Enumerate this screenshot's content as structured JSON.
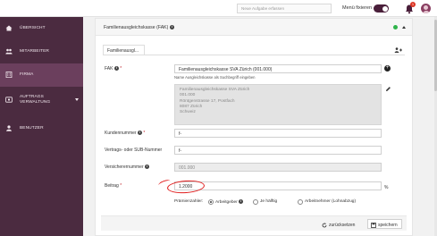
{
  "topbar": {
    "search_placeholder": "Neue Aufgabe erfassen",
    "menu_fix_label": "Menü fixieren",
    "notifications_count": "1"
  },
  "sidebar": {
    "items": [
      {
        "label": "Übersicht",
        "icon": "home-icon"
      },
      {
        "label": "Mitarbeiter",
        "icon": "users-icon"
      },
      {
        "label": "Firma",
        "icon": "building-icon",
        "active": true
      },
      {
        "label_line1": "Auftrags",
        "label_line2": "Verwaltung",
        "icon": "orders-icon"
      },
      {
        "label": "Benutzer",
        "icon": "user-icon"
      }
    ]
  },
  "panel": {
    "title": "Familienausgleichskasse (FAK)",
    "tab": "Familienausgl..."
  },
  "form": {
    "fak_label": "FAK",
    "fak_value": "Familienausgleichskasse SVA Zürich (001.000)",
    "fak_hint": "Name Ausgleichskasse als Suchbegriff eingeben",
    "address_lines": [
      "Familienausgleichskasse SVA Zürich",
      "001.000",
      "Röntgenstrasse 17, Postfach",
      "8087 Zürich",
      "Schweiz"
    ],
    "kundennummer_label": "Kundennummer",
    "kundennummer_value": "f-",
    "vertrag_label": "Vertrags- oder SUB-Nummer",
    "vertrag_value": "f-",
    "versicherer_label": "Versicherernummer",
    "versicherer_value": "001.000",
    "beitrag_label": "Beitrag",
    "beitrag_value": "1.2000",
    "percent_unit": "%",
    "praemien_label": "Prämienzahler:",
    "radio_options": [
      {
        "label": "Arbeitgeber",
        "selected": true
      },
      {
        "label": "Je hälftig",
        "selected": false
      },
      {
        "label": "Arbeitnehmer (Lohnabzug)",
        "selected": false
      }
    ]
  },
  "footer": {
    "reset_label": "zurücksetzen",
    "save_label": "speichern"
  },
  "colors": {
    "sidebar_bg": "#4b2b40",
    "sidebar_active": "#6b3f5d",
    "toggle": "#4a1f3a",
    "annotation": "#e01b1b"
  }
}
